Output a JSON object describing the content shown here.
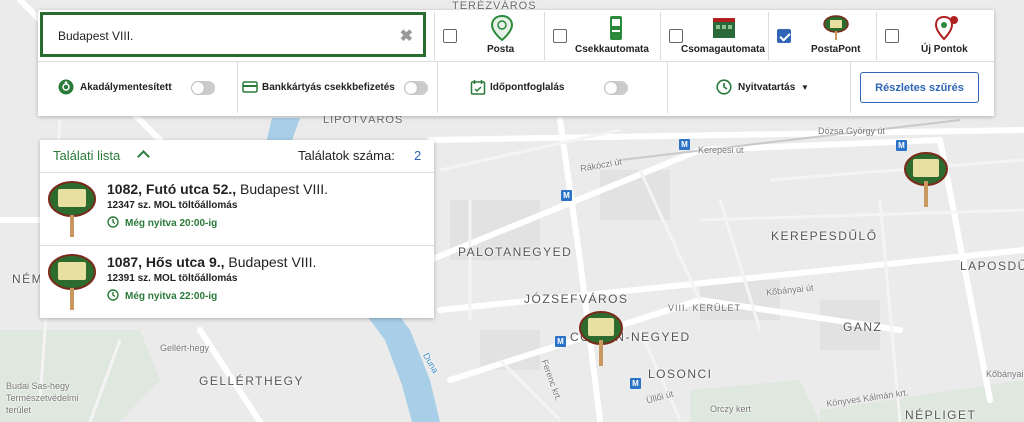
{
  "search": {
    "value": "Budapest VIII."
  },
  "categories": [
    {
      "label": "Posta",
      "checked": false,
      "icon": "posta-pin-icon"
    },
    {
      "label": "Csekkautomata",
      "checked": false,
      "icon": "check-machine-icon"
    },
    {
      "label": "Csomagautomata",
      "checked": false,
      "icon": "parcel-locker-icon"
    },
    {
      "label": "PostaPont",
      "checked": true,
      "icon": "postapont-icon"
    },
    {
      "label": "Új Pontok",
      "checked": false,
      "icon": "new-point-icon"
    }
  ],
  "options": {
    "accessible_label": "Akadálymentesített",
    "card_payment_label": "Bankkártyás csekkbefizetés",
    "appointment_label": "Időpontfoglalás",
    "opening_hours_label": "Nyitvatartás",
    "detail_filter_label": "Részletes szűrés"
  },
  "results": {
    "title": "Találati lista",
    "count_label": "Találatok száma:",
    "count": "2",
    "items": [
      {
        "street": "1082, Futó utca 52.,",
        "city": " Budapest VIII.",
        "station": "12347 sz. MOL töltőállomás",
        "hours": "Még nyitva 20:00-ig"
      },
      {
        "street": "1087, Hős utca 9.,",
        "city": " Budapest VIII.",
        "station": "12391 sz. MOL töltőállomás",
        "hours": "Még nyitva 22:00-ig"
      }
    ]
  },
  "map_labels": {
    "terezvaros": "TERÉZVÁROS",
    "lipotvaros": "LIPÓTVÁROS",
    "palotanegyed": "PALOTANEGYED",
    "jozsefvaros": "JÓZSEFVÁROS",
    "corvin": "CORVIN-NEGYED",
    "kerepesdulo": "KEREPESDŰLŐ",
    "laposdulo": "LAPOSDŰLŐ",
    "ganz": "GANZ",
    "losonci": "LOSONCI",
    "gellerthegy": "GELLÉRTHEGY",
    "nepliget": "NÉPLIGET",
    "kerulet": "VIII. KERÜLET",
    "nem": "NÉM",
    "kerepesi_ut": "Kerepesi út",
    "rakoczi_ut": "Rákóczi út",
    "dozsa": "Dózsa György út",
    "kobanyai": "Kőbányai út",
    "ulloi": "Üllői út",
    "orczy": "Orczy kert",
    "ferenc": "Ferenc krt.",
    "duna": "Duna",
    "gellert_hegy": "Gellért-hegy",
    "budai": "Budai Sas-hegy",
    "termeszet1": "Természetvédelmi",
    "termeszet2": "terület",
    "kobanyai2": "Kőbányai",
    "konyves": "Könyves Kálmán krt."
  },
  "colors": {
    "accent_green": "#2a6b30",
    "link_blue": "#3165b6",
    "metro_blue": "#2a73c9"
  }
}
